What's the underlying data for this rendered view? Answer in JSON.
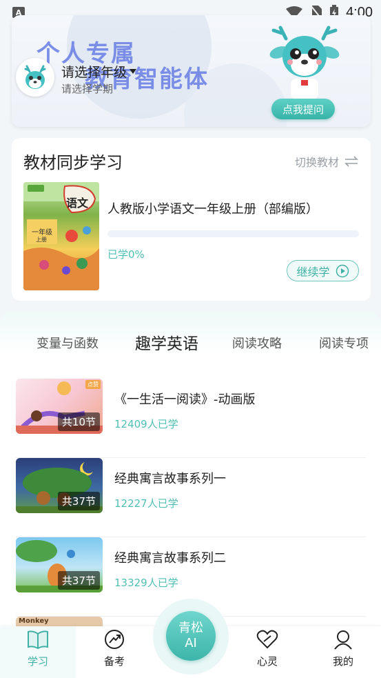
{
  "status_bar": {
    "time": "4:00",
    "notice_icon": "A"
  },
  "hero": {
    "title_line1": "个人专属",
    "title_line2": "教育智能体",
    "grade_label": "请选择年级",
    "term_label": "请选择学期",
    "ask_button": "点我提问"
  },
  "sync": {
    "title": "教材同步学习",
    "switch_label": "切换教材",
    "book_name": "人教版小学语文一年级上册（部编版）",
    "progress_percent": 0,
    "progress_text": "已学0%",
    "continue_label": "继续学",
    "cover_title": "语文",
    "cover_grade": "一年级",
    "cover_term": "上册"
  },
  "tabs": [
    {
      "label": "变量与函数"
    },
    {
      "label": "趣学英语"
    },
    {
      "label": "阅读攻略"
    },
    {
      "label": "阅读专项"
    }
  ],
  "courses": [
    {
      "title": "《一生活一阅读》-动画版",
      "lessons": "共10节",
      "learners": "12409人已学",
      "tag": "点赞"
    },
    {
      "title": "经典寓言故事系列一",
      "lessons": "共37节",
      "learners": "12227人已学"
    },
    {
      "title": "经典寓言故事系列二",
      "lessons": "共37节",
      "learners": "13329人已学"
    }
  ],
  "partial_thumb_text": "Monkey",
  "bottom_nav": {
    "study": "学习",
    "exam": "备考",
    "center_line1": "青松",
    "center_line2": "AI",
    "mind": "心灵",
    "mine": "我的"
  },
  "colors": {
    "accent": "#3fb0a5",
    "hero_title": "#6e83e6"
  }
}
